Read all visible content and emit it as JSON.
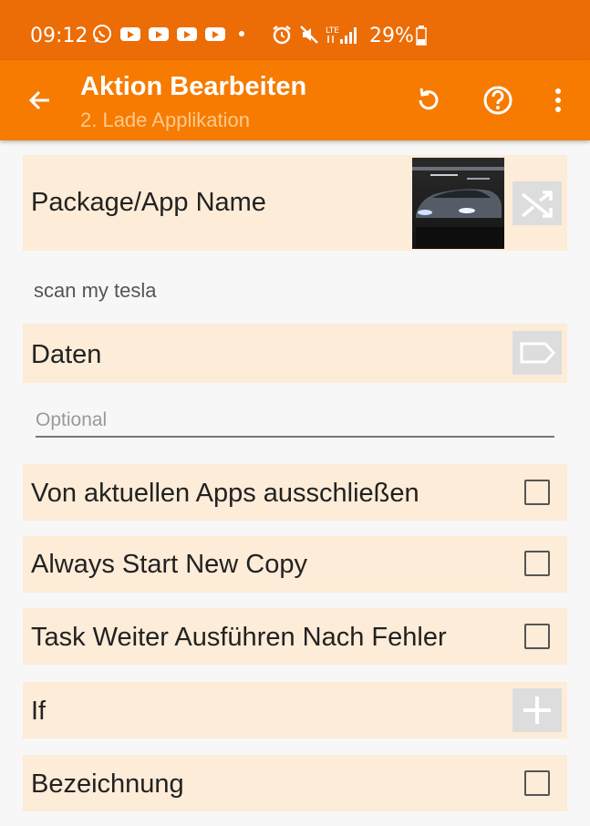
{
  "status_bar": {
    "time": "09:12",
    "battery": "29%",
    "network": "LTE"
  },
  "app_bar": {
    "title": "Aktion Bearbeiten",
    "subtitle": "2. Lade Applikation"
  },
  "form": {
    "package_label": "Package/App Name",
    "package_value": "scan my tesla",
    "data_label": "Daten",
    "data_placeholder": "Optional",
    "exclude_label": "Von aktuellen Apps ausschließen",
    "always_new_label": "Always Start New Copy",
    "continue_label": "Task Weiter Ausführen Nach Fehler",
    "if_label": "If",
    "label_label": "Bezeichnung"
  },
  "colors": {
    "status_bar": "#ec6c06",
    "app_bar": "#f67b00",
    "row_background": "#fdecd8"
  }
}
